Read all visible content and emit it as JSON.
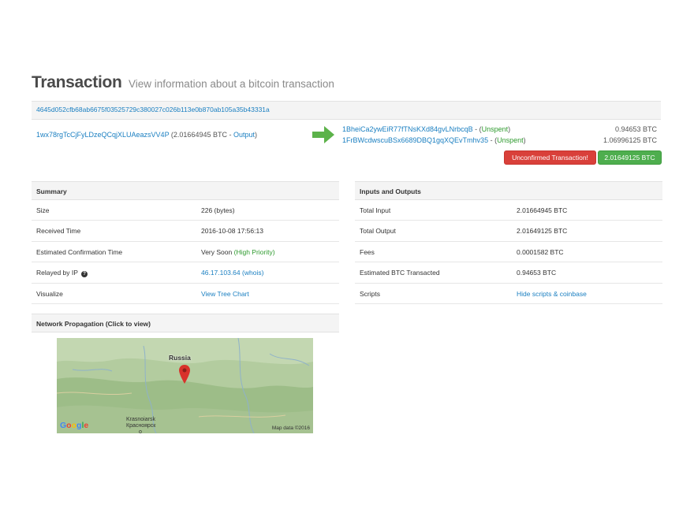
{
  "header": {
    "title": "Transaction",
    "subtitle": "View information about a bitcoin transaction"
  },
  "tx_hash": "4645d052cfb68ab6675f03525729c380027c026b113e0b870ab105a35b43331a",
  "input": {
    "address": "1wx78rgTcCjFyLDzeQCqjXLUAeazsVV4P",
    "amount": "(2.01664945 BTC - ",
    "link_label": "Output",
    "close": ")"
  },
  "outputs": [
    {
      "address": "1BheiCa2ywEiR77fTNsKXd84gvLNrbcqB",
      "sep": " - (",
      "status": "Unspent",
      "close": ")",
      "amount": "0.94653 BTC"
    },
    {
      "address": "1FrBWcdwscuBSx6689DBQ1gqXQEvTmhv35",
      "sep": " - (",
      "status": "Unspent",
      "close": ")",
      "amount": "1.06996125 BTC"
    }
  ],
  "buttons": {
    "unconfirmed": "Unconfirmed Transaction!",
    "total": "2.01649125 BTC"
  },
  "summary": {
    "title": "Summary",
    "size_label": "Size",
    "size_value": "226 (bytes)",
    "received_label": "Received Time",
    "received_value": "2016-10-08 17:56:13",
    "confirm_label": "Estimated Confirmation Time",
    "confirm_value": "Very Soon",
    "confirm_priority": "(High Priority)",
    "relayed_label": "Relayed by IP",
    "relayed_ip": "46.17.103.64",
    "relayed_whois": "(whois)",
    "visualize_label": "Visualize",
    "visualize_link": "View Tree Chart"
  },
  "io": {
    "title": "Inputs and Outputs",
    "total_input_label": "Total Input",
    "total_input_value": "2.01664945 BTC",
    "total_output_label": "Total Output",
    "total_output_value": "2.01649125 BTC",
    "fees_label": "Fees",
    "fees_value": "0.0001582 BTC",
    "est_label": "Estimated BTC Transacted",
    "est_value": "0.94653 BTC",
    "scripts_label": "Scripts",
    "scripts_link": "Hide scripts & coinbase"
  },
  "network": {
    "title": "Network Propagation (Click to view)",
    "map_country": "Russia",
    "map_city_1": "Krasnoiarsk",
    "map_city_2": "Красноярск",
    "map_city_3": "o",
    "google": "Google",
    "map_data": "Map data ©2016"
  },
  "icons": {
    "arrow": "right-arrow-icon",
    "help": "question-circle-icon",
    "pin": "map-pin-icon"
  },
  "colors": {
    "link": "#1a7fc1",
    "success": "#2e9a2e",
    "danger_button": "#d9403a",
    "success_button": "#4eae4e",
    "arrow": "#5cb24a",
    "pin": "#d8322b"
  }
}
